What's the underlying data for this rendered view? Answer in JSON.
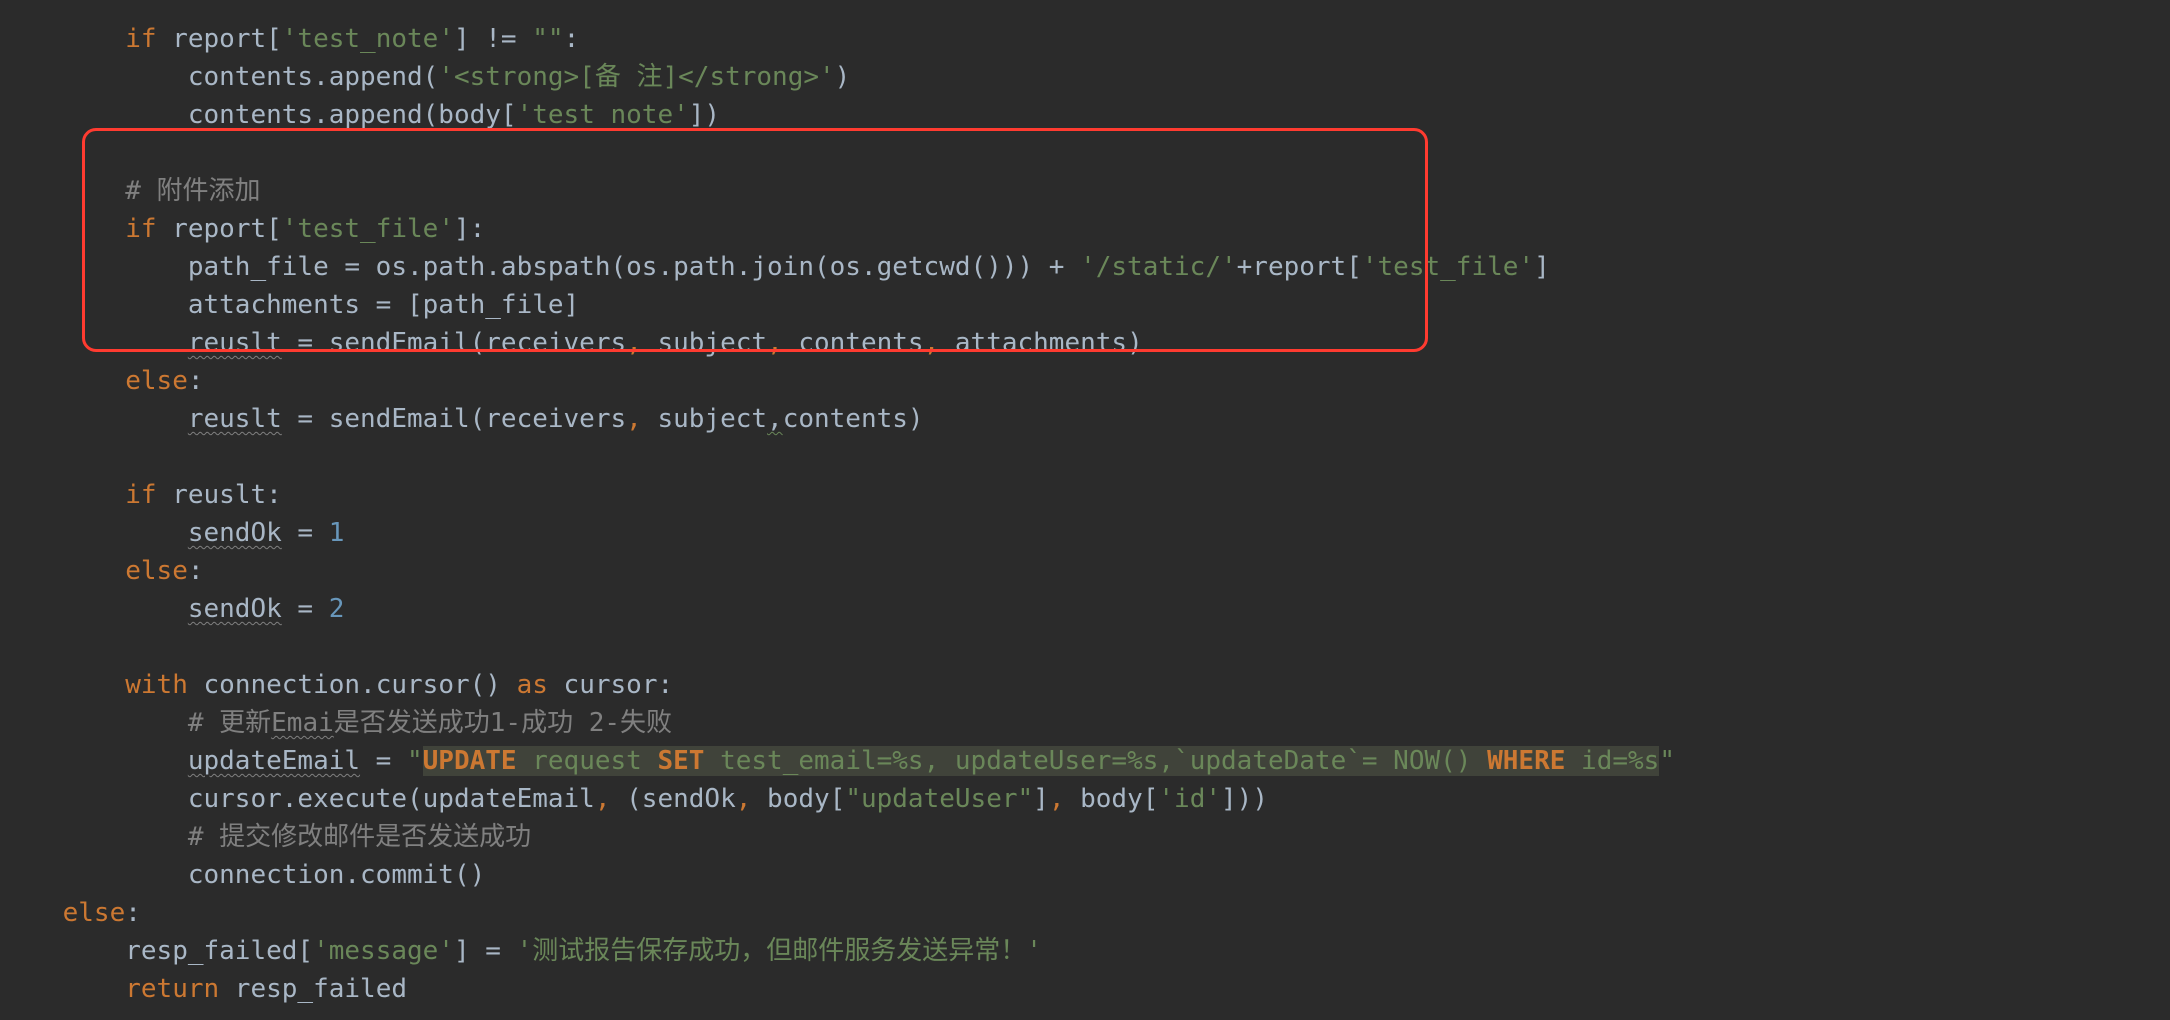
{
  "code": {
    "indent": {
      "i4": "    ",
      "i8": "        ",
      "i12": "            ",
      "i16": "                "
    },
    "l1": {
      "a": "if",
      "b": " report[",
      "c": "'test_note'",
      "d": "] != ",
      "e": "\"\"",
      "f": ":"
    },
    "l2": {
      "a": "contents.append(",
      "b": "'<strong>[备 注]</strong>'",
      "c": ")"
    },
    "l3": {
      "a": "contents.append(body[",
      "b": "'test_note'",
      "c": "])"
    },
    "l5": {
      "a": "# 附件添加"
    },
    "l6": {
      "a": "if",
      "b": " report[",
      "c": "'test_file'",
      "d": "]:"
    },
    "l7": {
      "a": "path_file = os.path.abspath(os.path.join(os.getcwd())) + ",
      "b": "'/static/'",
      "c": "+report[",
      "d": "'test_file'",
      "e": "]"
    },
    "l8": {
      "a": "attachments = [path_file]"
    },
    "l9": {
      "a": "reuslt",
      "b": " = sendEmail(receivers",
      "c": ",",
      "d": " subject",
      "e": ",",
      "f": " contents",
      "g": ",",
      "h": " attachments)"
    },
    "l10": {
      "a": "else",
      "b": ":"
    },
    "l11": {
      "a": "reuslt",
      "b": " = sendEmail(receivers",
      "c": ",",
      "d": " subject",
      "e": ",",
      "f": "contents)"
    },
    "l13": {
      "a": "if",
      "b": " reuslt:"
    },
    "l14": {
      "a": "sendOk",
      "b": " = ",
      "c": "1"
    },
    "l15": {
      "a": "else",
      "b": ":"
    },
    "l16": {
      "a": "sendOk",
      "b": " = ",
      "c": "2"
    },
    "l18": {
      "a": "with",
      "b": " connection.cursor() ",
      "c": "as",
      "d": " cursor:"
    },
    "l19": {
      "a": "# 更新",
      "b": "Emai",
      "c": "是否发送成功1-成功 2-失败"
    },
    "l20": {
      "a": "updateEmail",
      "b": " = ",
      "q": "\"",
      "s1": "UPDATE",
      "s2": " request ",
      "s3": "SET",
      "s4": " test_email=%s, updateUser=%s,`updateDate`= NOW() ",
      "s5": "WHERE",
      "s6": " id=%s",
      "q2": "\""
    },
    "l21": {
      "a": "cursor.execute(updateEmail",
      "b": ",",
      "c": " (sendOk",
      "d": ",",
      "e": " body[",
      "f": "\"updateUser\"",
      "g": "]",
      "h": ",",
      "i": " body[",
      "j": "'id'",
      "k": "]))"
    },
    "l22": {
      "a": "# 提交修改邮件是否发送成功"
    },
    "l23": {
      "a": "connection.commit()"
    },
    "l24": {
      "a": "else",
      "b": ":"
    },
    "l25": {
      "a": "resp_failed[",
      "b": "'message'",
      "c": "] = ",
      "d": "'测试报告保存成功，但邮件服务发送异常！'"
    },
    "l26": {
      "a": "return",
      "b": " resp_failed"
    }
  }
}
